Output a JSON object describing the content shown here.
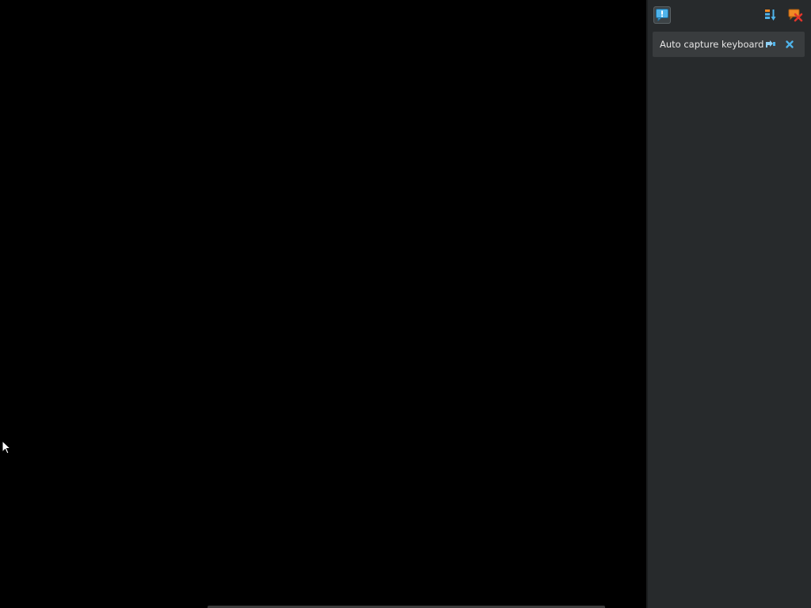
{
  "window": {
    "title": ""
  },
  "side_panel": {
    "toolbar": {
      "notifications_icon": "speech-bubble-exclamation-icon",
      "sort_icon": "sort-descending-icon",
      "clear_all_icon": "clear-notifications-icon"
    },
    "notifications": [
      {
        "text": "Auto capture keyboard ...",
        "pin_icon": "pin-icon",
        "close_icon": "close-icon"
      }
    ]
  },
  "colors": {
    "panel_bg": "#272a2c",
    "notification_bg": "#393c3e",
    "accent_blue": "#4fb3ea",
    "accent_orange": "#f08a24",
    "accent_red": "#e0342a",
    "guest_bg": "#000000"
  }
}
